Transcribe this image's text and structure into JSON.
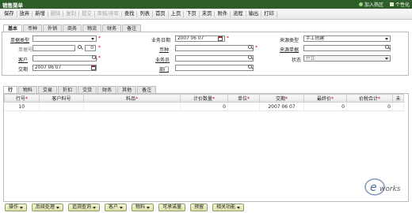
{
  "window": {
    "title": "销售渠单",
    "join_zone": "加入热区",
    "personalize": "个性化"
  },
  "toolbar": [
    {
      "label": "保存",
      "disabled": false
    },
    {
      "label": "放弃",
      "disabled": false
    },
    {
      "label": "新增",
      "disabled": false
    },
    {
      "label": "删除",
      "disabled": true
    },
    {
      "label": "复制",
      "disabled": true
    },
    {
      "label": "提交",
      "disabled": true
    },
    {
      "label": "审核/弃审",
      "disabled": true
    },
    {
      "label": "查找",
      "disabled": false
    },
    {
      "label": "列表",
      "disabled": false
    },
    {
      "label": "首页",
      "disabled": false
    },
    {
      "label": "上页",
      "disabled": false
    },
    {
      "label": "下页",
      "disabled": false
    },
    {
      "label": "末页",
      "disabled": false
    },
    {
      "label": "附件",
      "disabled": false
    },
    {
      "label": "流程",
      "disabled": false
    },
    {
      "label": "输出",
      "disabled": false
    },
    {
      "label": "打印",
      "disabled": false
    }
  ],
  "header_tabs": [
    "基本",
    "币种",
    "外销",
    "商务",
    "物流",
    "财务",
    "备注"
  ],
  "form": {
    "doc_type_label": "单据类型",
    "doc_no_label": "单据号",
    "doc_no_value": "0",
    "customer_label": "客户",
    "delivery_label": "交期",
    "delivery_value": "2007 06 07",
    "biz_date_label": "业务日期",
    "biz_date_value": "2007 06 07",
    "currency_label": "币种",
    "salesman_label": "业务员",
    "dept_label": "部门",
    "source_type_label": "来源类型",
    "source_type_value": "手工创建",
    "source_no_label": "来源单据",
    "status_label": "状态",
    "status_value": "开立"
  },
  "detail_tabs": [
    "行",
    "物料",
    "交易",
    "折扣",
    "交货",
    "财务",
    "其他",
    "备注"
  ],
  "grid": {
    "columns": [
      "行号",
      "客户料号",
      "料品",
      "计价数量",
      "单位",
      "交期",
      "最终价",
      "价税合计",
      "未"
    ],
    "required": [
      true,
      false,
      true,
      true,
      true,
      true,
      true,
      true,
      false
    ],
    "rows": [
      [
        "10",
        "",
        "",
        "0",
        "",
        "2007 06 07",
        "0",
        "0",
        ""
      ]
    ]
  },
  "bottom_buttons": [
    "操作",
    "后续处理",
    "追溯查询",
    "客户",
    "物料",
    "可承诺量",
    "预留",
    "相关功能"
  ],
  "bottom_dropdown": [
    true,
    true,
    true,
    true,
    true,
    false,
    false,
    true
  ],
  "logo": {
    "letter": "e",
    "text": "works"
  },
  "colors": {
    "titlebar": "#2f5d2a",
    "button_fill": "#dedca4",
    "required": "#dd0000"
  }
}
